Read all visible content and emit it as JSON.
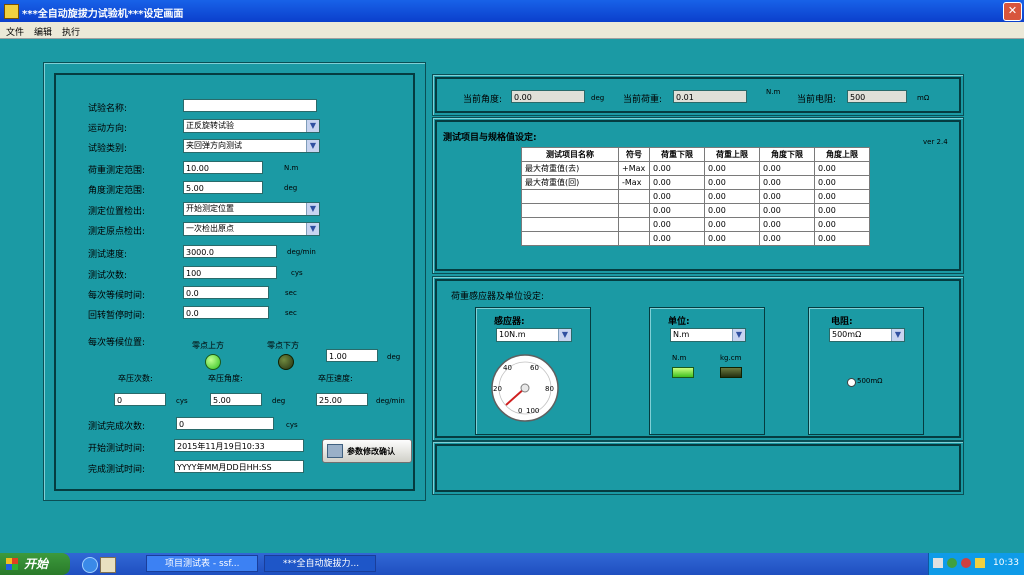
{
  "window": {
    "title": "***全自动旋拔力试验机***设定画面"
  },
  "menu": {
    "items": [
      "文件",
      "编辑",
      "执行"
    ]
  },
  "form": {
    "test_name": {
      "label": "试验名称:",
      "value": ""
    },
    "direction": {
      "label": "运动方向:",
      "value": "正反旋转试验"
    },
    "test_type": {
      "label": "试验类别:",
      "value": "夹回弹方向测试"
    },
    "torque_range": {
      "label": "荷重测定范围:",
      "value": "10.00",
      "unit": "N.m"
    },
    "angle_range": {
      "label": "角度测定范围:",
      "value": "5.00",
      "unit": "deg"
    },
    "pos_detect": {
      "label": "测定位置检出:",
      "value": "开始测定位置"
    },
    "origin_detect": {
      "label": "测定原点检出:",
      "value": "一次检出原点"
    },
    "speed": {
      "label": "测试速度:",
      "value": "3000.0",
      "unit": "deg/min"
    },
    "count": {
      "label": "测试次数:",
      "value": "100",
      "unit": "cys"
    },
    "wait_time": {
      "label": "每次等候时间:",
      "value": "0.0",
      "unit": "sec"
    },
    "return_time": {
      "label": "回转暂停时间:",
      "value": "0.0",
      "unit": "sec"
    },
    "wait_pos": {
      "label": "每次等候位置:",
      "upper_label": "零点上方",
      "lower_label": "零点下方",
      "value": "1.00",
      "unit": "deg"
    },
    "press_count": {
      "label": "卒压次数:",
      "value": "0",
      "unit": "cys"
    },
    "press_angle": {
      "label": "卒压角度:",
      "value": "5.00",
      "unit": "deg"
    },
    "press_speed": {
      "label": "卒压速度:",
      "value": "25.00",
      "unit": "deg/min"
    },
    "done_count": {
      "label": "测试完成次数:",
      "value": "0",
      "unit": "cys"
    },
    "start_time": {
      "label": "开始测试时间:",
      "value": "2015年11月19日10:33"
    },
    "end_time": {
      "label": "完成测试时间:",
      "value": "YYYY年MM月DD日HH:SS"
    },
    "confirm_button": "参数修改确认"
  },
  "status": {
    "angle": {
      "label": "当前角度:",
      "value": "0.00",
      "unit": "deg"
    },
    "torque": {
      "label": "当前荷重:",
      "value": "0.01",
      "unit": "N.m"
    },
    "resistance": {
      "label": "当前电阻:",
      "value": "500",
      "unit": "mΩ"
    }
  },
  "spec": {
    "title": "测试项目与规格值设定:",
    "version": "ver 2.4",
    "columns": [
      "测试项目名称",
      "符号",
      "荷重下限",
      "荷重上限",
      "角度下限",
      "角度上限"
    ],
    "rows": [
      [
        "最大荷重值(去)",
        "+Max",
        "0.00",
        "0.00",
        "0.00",
        "0.00"
      ],
      [
        "最大荷重值(回)",
        "-Max",
        "0.00",
        "0.00",
        "0.00",
        "0.00"
      ],
      [
        "",
        "",
        "0.00",
        "0.00",
        "0.00",
        "0.00"
      ],
      [
        "",
        "",
        "0.00",
        "0.00",
        "0.00",
        "0.00"
      ],
      [
        "",
        "",
        "0.00",
        "0.00",
        "0.00",
        "0.00"
      ],
      [
        "",
        "",
        "0.00",
        "0.00",
        "0.00",
        "0.00"
      ]
    ]
  },
  "sensor": {
    "title": "荷重感应器及单位设定:",
    "sensor_label": "感应器:",
    "sensor_value": "10N.m",
    "gauge_ticks": [
      "0",
      "20",
      "40",
      "60",
      "80",
      "100"
    ],
    "unit_label": "单位:",
    "unit_value": "N.m",
    "unit_options": [
      "N.m",
      "kg.cm"
    ],
    "res_label": "电阻:",
    "res_value": "500mΩ",
    "res_radio": "500mΩ"
  },
  "taskbar": {
    "start": "开始",
    "tasks": [
      "项目测试表 - ssf...",
      "***全自动旋拔力..."
    ],
    "clock": "10:33"
  }
}
